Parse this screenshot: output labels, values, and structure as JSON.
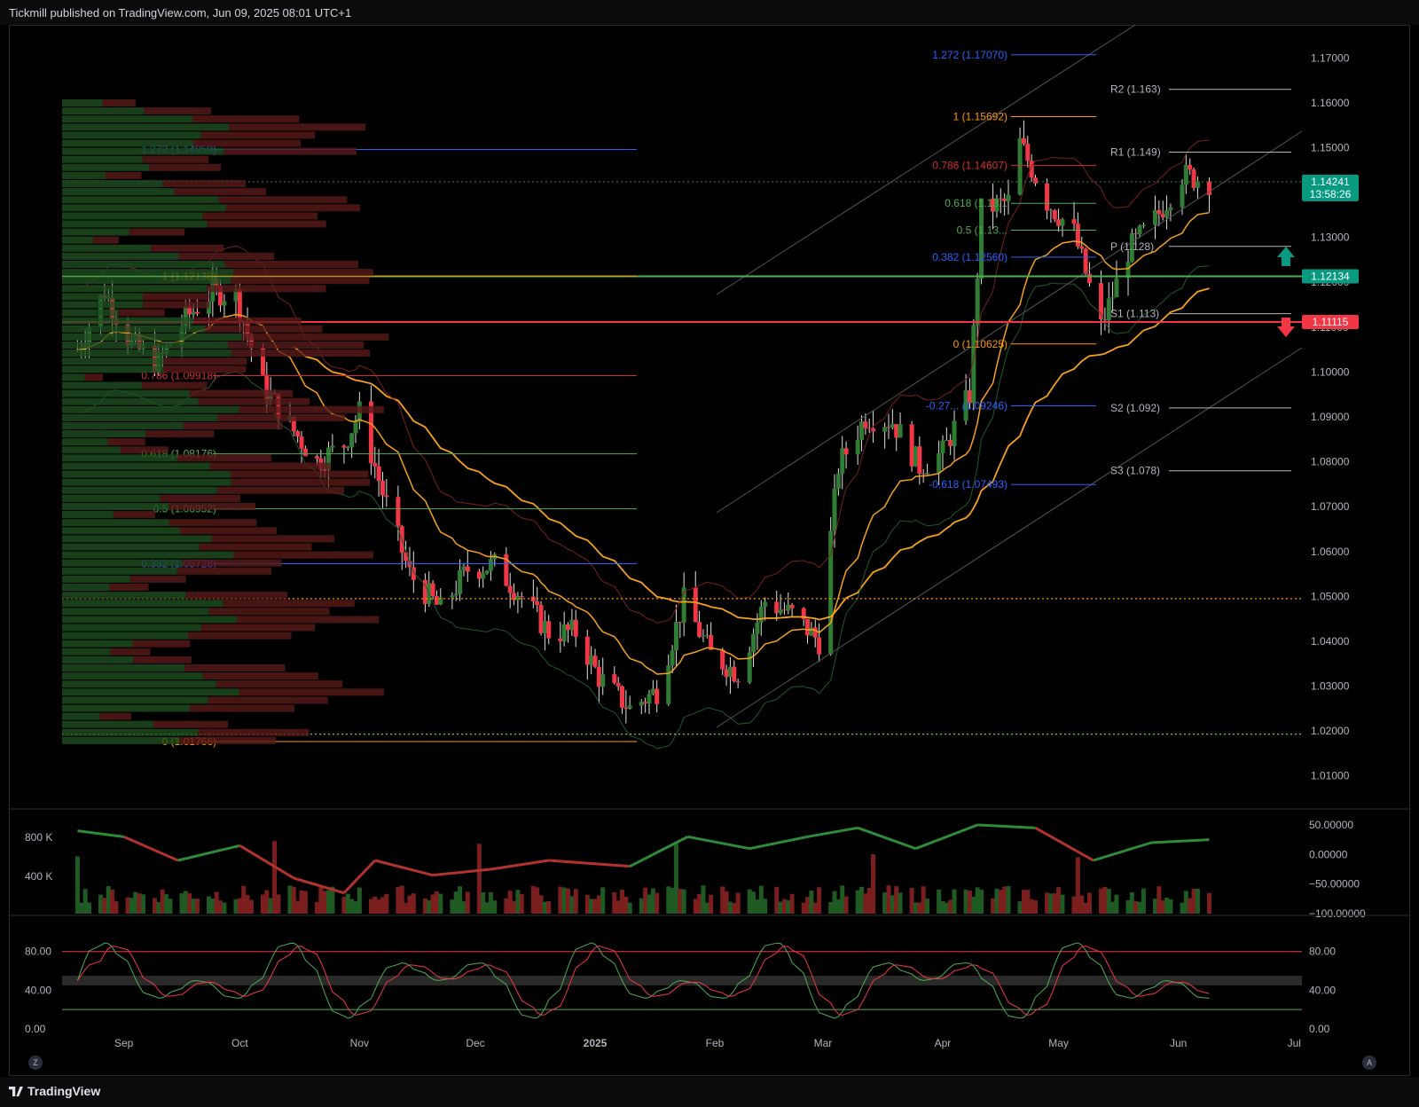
{
  "header": {
    "published_text": "Tickmill published on TradingView.com, Jun 09, 2025 08:01 UTC+1"
  },
  "footer": {
    "brand": "TradingView",
    "left_btn": "Z",
    "right_btn": "A"
  },
  "colors": {
    "up": "#2e7d32",
    "down": "#f23645",
    "fib_blue": "#2962ff",
    "fib_orange": "#ff9800",
    "fib_red": "#d32f2f",
    "fib_green": "#4caf50",
    "ema": "#f7a21b",
    "price_green": "#089981",
    "price_red": "#f23645"
  },
  "chart_data": [
    {
      "type": "candlestick",
      "symbol_hint": "EURUSD daily",
      "ylim": [
        1.005,
        1.175
      ],
      "x_ticks": [
        "Sep",
        "Oct",
        "Nov",
        "Dec",
        "2025",
        "Feb",
        "Mar",
        "Apr",
        "May",
        "Jun",
        "Jul"
      ],
      "y_ticks": [
        "1.17000",
        "1.16000",
        "1.15000",
        "1.14000",
        "1.13000",
        "1.12000",
        "1.11000",
        "1.10000",
        "1.09000",
        "1.08000",
        "1.07000",
        "1.06000",
        "1.05000",
        "1.04000",
        "1.03000",
        "1.02000",
        "1.01000"
      ],
      "price_path": [
        [
          "2024-08-20",
          1.105
        ],
        [
          "2024-08-27",
          1.118
        ],
        [
          "2024-09-03",
          1.106
        ],
        [
          "2024-09-10",
          1.102
        ],
        [
          "2024-09-17",
          1.112
        ],
        [
          "2024-09-24",
          1.118
        ],
        [
          "2024-09-30",
          1.117
        ],
        [
          "2024-10-07",
          1.097
        ],
        [
          "2024-10-14",
          1.088
        ],
        [
          "2024-10-21",
          1.08
        ],
        [
          "2024-10-28",
          1.084
        ],
        [
          "2024-11-01",
          1.091
        ],
        [
          "2024-11-07",
          1.073
        ],
        [
          "2024-11-14",
          1.055
        ],
        [
          "2024-11-22",
          1.047
        ],
        [
          "2024-11-29",
          1.056
        ],
        [
          "2024-12-06",
          1.057
        ],
        [
          "2024-12-13",
          1.05
        ],
        [
          "2024-12-20",
          1.042
        ],
        [
          "2024-12-27",
          1.042
        ],
        [
          "2025-01-02",
          1.032
        ],
        [
          "2025-01-10",
          1.025
        ],
        [
          "2025-01-17",
          1.029
        ],
        [
          "2025-01-24",
          1.049
        ],
        [
          "2025-01-31",
          1.037
        ],
        [
          "2025-02-07",
          1.033
        ],
        [
          "2025-02-14",
          1.049
        ],
        [
          "2025-02-21",
          1.046
        ],
        [
          "2025-02-28",
          1.04
        ],
        [
          "2025-03-05",
          1.079
        ],
        [
          "2025-03-12",
          1.09
        ],
        [
          "2025-03-19",
          1.089
        ],
        [
          "2025-03-26",
          1.079
        ],
        [
          "2025-04-01",
          1.082
        ],
        [
          "2025-04-08",
          1.095
        ],
        [
          "2025-04-11",
          1.136
        ],
        [
          "2025-04-18",
          1.138
        ],
        [
          "2025-04-21",
          1.151
        ],
        [
          "2025-04-28",
          1.138
        ],
        [
          "2025-05-05",
          1.131
        ],
        [
          "2025-05-12",
          1.11
        ],
        [
          "2025-05-19",
          1.127
        ],
        [
          "2025-05-26",
          1.134
        ],
        [
          "2025-06-02",
          1.144
        ],
        [
          "2025-06-09",
          1.1424
        ]
      ],
      "price_labels": [
        {
          "value": 1.14241,
          "text": "1.14241",
          "subtext": "13:58:26",
          "color": "#089981"
        },
        {
          "value": 1.12134,
          "text": "1.12134",
          "color": "#089981"
        },
        {
          "value": 1.11115,
          "text": "1.11115",
          "color": "#f23645"
        }
      ],
      "fib_left": [
        {
          "label": "1.272 (1.14959)",
          "value": 1.14959,
          "color": "#2962ff"
        },
        {
          "label": "1 (1.12138)",
          "value": 1.12138,
          "color": "#ff9800"
        },
        {
          "label": "0.786 (1.09918)",
          "value": 1.09918,
          "color": "#d32f2f"
        },
        {
          "label": "0.618 (1.08176)",
          "value": 1.08176,
          "color": "#4caf50"
        },
        {
          "label": "0.5 (1.06952)",
          "value": 1.06952,
          "color": "#4caf50"
        },
        {
          "label": "0.382 (1.05728)",
          "value": 1.05728,
          "color": "#2962ff"
        },
        {
          "label": "0 (1.01766)",
          "value": 1.01766,
          "color": "#ff9800"
        }
      ],
      "fib_right": [
        {
          "label": "1.272 (1.17070)",
          "value": 1.1707,
          "color": "#2962ff"
        },
        {
          "label": "1 (1.15692)",
          "value": 1.15692,
          "color": "#ff9800"
        },
        {
          "label": "0.786 (1.14607)",
          "value": 1.14607,
          "color": "#d32f2f"
        },
        {
          "label": "0.618 (1.13...",
          "value": 1.1376,
          "color": "#4caf50"
        },
        {
          "label": "0.5 (1.13...",
          "value": 1.1316,
          "color": "#4caf50"
        },
        {
          "label": "0.382 (1.12560)",
          "value": 1.1256,
          "color": "#2962ff"
        },
        {
          "label": "0 (1.10625)",
          "value": 1.10625,
          "color": "#ff9800"
        },
        {
          "label": "-0.27... (1.09246)",
          "value": 1.09246,
          "color": "#2962ff"
        },
        {
          "label": "-0.618 (1.07493)",
          "value": 1.07493,
          "color": "#2962ff"
        }
      ],
      "pivots": [
        {
          "label": "R2 (1.163)",
          "value": 1.163
        },
        {
          "label": "R1 (1.149)",
          "value": 1.149
        },
        {
          "label": "P (1.128)",
          "value": 1.128
        },
        {
          "label": "S1 (1.113)",
          "value": 1.113
        },
        {
          "label": "S2 (1.092)",
          "value": 1.092
        },
        {
          "label": "S3 (1.078)",
          "value": 1.078
        }
      ],
      "horizontal_lines": [
        {
          "value": 1.12134,
          "color": "#4caf50"
        },
        {
          "value": 1.11115,
          "color": "#f23645"
        },
        {
          "value": 1.0495,
          "color": "#ff9800",
          "style": "dotted"
        },
        {
          "value": 1.0193,
          "color": "#8bc34a",
          "style": "dotted"
        },
        {
          "value": 1.1424,
          "color": "#2e7d32",
          "style": "dotted"
        }
      ]
    },
    {
      "type": "volume_with_oscillator",
      "y_ticks_left": [
        "800 K",
        "400 K"
      ],
      "y_ticks_right": [
        "50.00000",
        "0.00000",
        "−50.00000",
        "−100.00000"
      ],
      "oscillator_path": [
        [
          "2024-08-20",
          40
        ],
        [
          "2024-09-01",
          30
        ],
        [
          "2024-09-15",
          -10
        ],
        [
          "2024-10-01",
          15
        ],
        [
          "2024-10-15",
          -40
        ],
        [
          "2024-10-28",
          -65
        ],
        [
          "2024-11-05",
          -10
        ],
        [
          "2024-11-20",
          -35
        ],
        [
          "2024-12-05",
          -25
        ],
        [
          "2024-12-20",
          -10
        ],
        [
          "2025-01-10",
          -20
        ],
        [
          "2025-01-25",
          30
        ],
        [
          "2025-02-10",
          10
        ],
        [
          "2025-02-25",
          30
        ],
        [
          "2025-03-10",
          45
        ],
        [
          "2025-03-25",
          10
        ],
        [
          "2025-04-10",
          50
        ],
        [
          "2025-04-25",
          45
        ],
        [
          "2025-05-10",
          -10
        ],
        [
          "2025-05-25",
          20
        ],
        [
          "2025-06-09",
          25
        ]
      ]
    },
    {
      "type": "stochastic",
      "y_ticks": [
        "80.00",
        "40.00",
        "0.00"
      ],
      "levels": [
        80,
        20
      ],
      "band": [
        45,
        55
      ]
    }
  ]
}
